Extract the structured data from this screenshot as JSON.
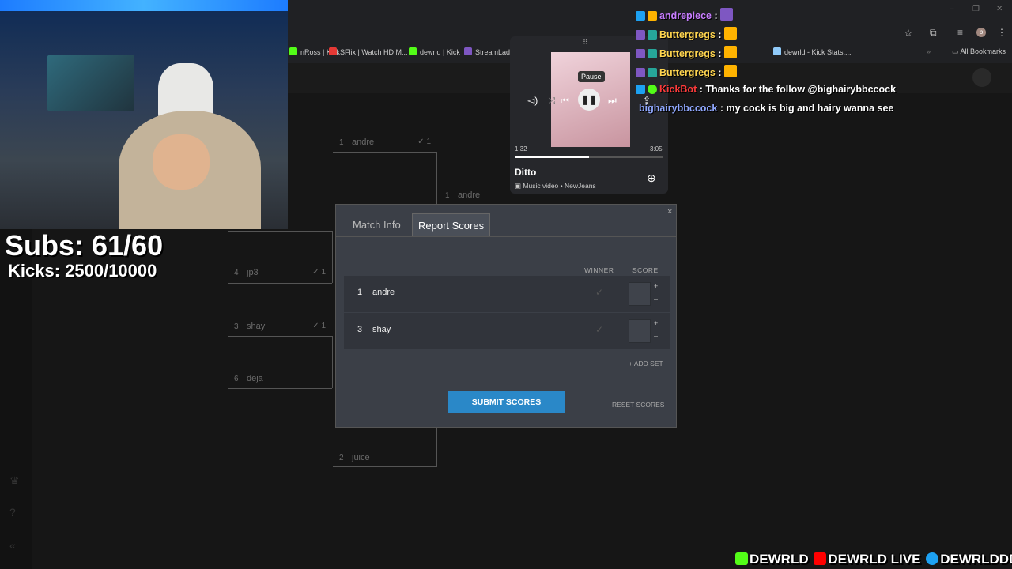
{
  "browser": {
    "bookmarks": [
      {
        "label": "nRoss | Kick",
        "color": "#53fc18"
      },
      {
        "label": "SFlix | Watch HD M...",
        "color": "#e53935"
      },
      {
        "label": "dewrld | Kick",
        "color": "#53fc18"
      },
      {
        "label": "StreamLadde",
        "color": "#7e57c2"
      },
      {
        "label": "dewrld - Kick Stats,...",
        "color": "#90caf9"
      }
    ],
    "all_bookmarks": "All Bookmarks",
    "profile_initial": "b"
  },
  "overlay": {
    "subs": "Subs: 61/60",
    "kicks": "Kicks: 2500/10000",
    "socials": [
      "DEWRLD",
      "DEWRLD LIVE",
      "DEWRLDDD"
    ],
    "social_colors": {
      "kick": "#53fc18",
      "youtube": "#ff0000",
      "twitter": "#1da1f2"
    }
  },
  "chat": [
    {
      "user": "andrepiece",
      "sep": " :",
      "text": "",
      "color": "#c77dff"
    },
    {
      "user": "Buttergregs",
      "sep": " :",
      "text": "",
      "color": "#ffd54f"
    },
    {
      "user": "Buttergregs",
      "sep": " :",
      "text": "",
      "color": "#ffd54f"
    },
    {
      "user": "Buttergregs",
      "sep": " :",
      "text": "",
      "color": "#ffd54f"
    },
    {
      "user": "KickBot",
      "sep": " :",
      "text": " Thanks for the follow @bighairybbccock",
      "color": "#ff3b3b"
    },
    {
      "user": "bighairybbccock",
      "sep": " :",
      "text": " my cock is big and hairy wanna see",
      "color": "#90a8ff"
    }
  ],
  "media": {
    "tooltip": "Pause",
    "elapsed": "1:32",
    "duration": "3:05",
    "progress": 0.5,
    "title": "Ditto",
    "subtitle": "Music video • NewJeans"
  },
  "bracket": [
    {
      "seed": "1",
      "name": "andre",
      "check": "✓ 1"
    },
    {
      "seed": "1",
      "name": "andre",
      "check": ""
    },
    {
      "seed": "4",
      "name": "jp3",
      "check": "✓ 1"
    },
    {
      "seed": "3",
      "name": "shay",
      "check": "✓ 1"
    },
    {
      "seed": "6",
      "name": "deja",
      "check": ""
    },
    {
      "seed": "2",
      "name": "juice",
      "check": ""
    }
  ],
  "modal": {
    "tabs": [
      "Match Info",
      "Report Scores"
    ],
    "active_tab": 1,
    "col_winner": "WINNER",
    "col_score": "SCORE",
    "rows": [
      {
        "seed": "1",
        "name": "andre",
        "score": ""
      },
      {
        "seed": "3",
        "name": "shay",
        "score": ""
      }
    ],
    "add_set": "+ ADD SET",
    "submit": "SUBMIT SCORES",
    "reset": "RESET SCORES",
    "close": "×"
  }
}
